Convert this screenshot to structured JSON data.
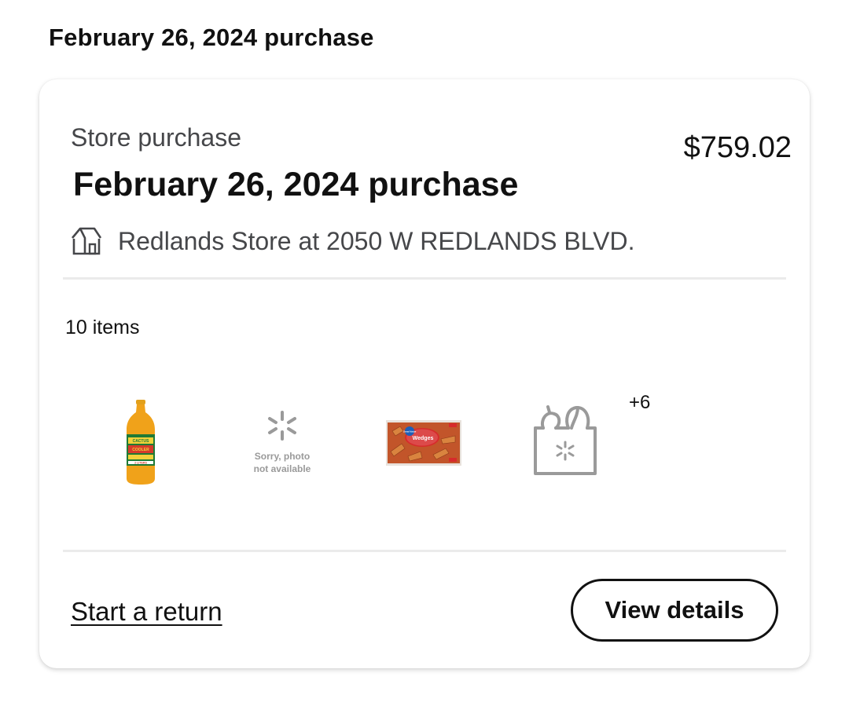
{
  "section_heading": "February 26, 2024 purchase",
  "card": {
    "purchase_type": "Store purchase",
    "title": "February 26, 2024 purchase",
    "total": "$759.02",
    "store": {
      "icon": "store-icon",
      "label": "Redlands Store at 2050 W REDLANDS BLVD."
    },
    "items_count": "10 items",
    "thumbnails": [
      {
        "name": "soda-bottle-thumbnail",
        "kind": "product",
        "text": [
          "CACTUS",
          "COOLER",
          "2 LITERS"
        ]
      },
      {
        "name": "photo-unavailable-thumbnail",
        "kind": "placeholder",
        "text": [
          "Sorry, photo",
          "not available"
        ]
      },
      {
        "name": "potato-wedges-thumbnail",
        "kind": "product",
        "text": [
          "Great Value",
          "Wedges"
        ]
      },
      {
        "name": "grocery-bag-thumbnail",
        "kind": "placeholder",
        "text": []
      }
    ],
    "more_count": "+6",
    "actions": {
      "return_label": "Start a return",
      "details_label": "View details"
    }
  },
  "colors": {
    "text_primary": "#111111",
    "text_secondary": "#46474a",
    "divider": "#ebebeb",
    "placeholder_gray": "#9a9a9a"
  }
}
